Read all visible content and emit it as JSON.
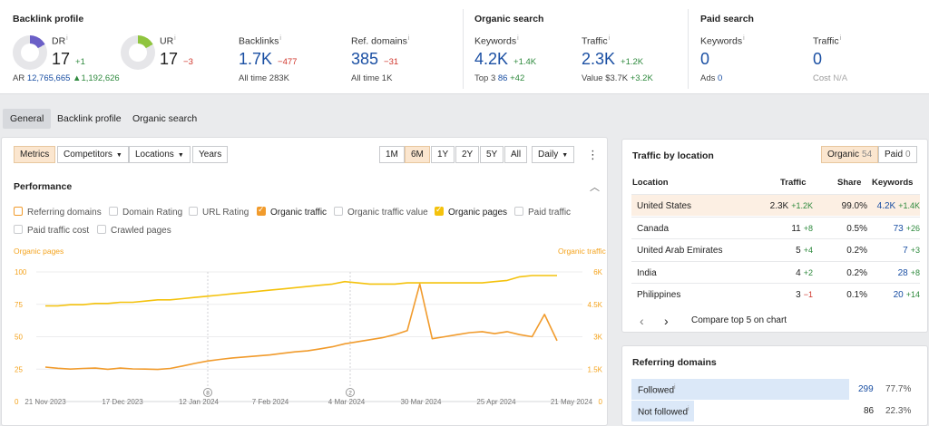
{
  "backlink_profile": {
    "title": "Backlink profile",
    "dr": {
      "label": "DR",
      "value": "17",
      "delta": "+1",
      "donut_fraction": 0.17
    },
    "ar": {
      "label": "AR",
      "value": "12,765,665",
      "delta": "1,192,626"
    },
    "ur": {
      "label": "UR",
      "value": "17",
      "delta": "−3",
      "donut_fraction": 0.17
    },
    "backlinks": {
      "label": "Backlinks",
      "value": "1.7K",
      "delta": "−477",
      "sub_label": "All time",
      "sub_value": "283K"
    },
    "ref_domains": {
      "label": "Ref. domains",
      "value": "385",
      "delta": "−31",
      "sub_label": "All time",
      "sub_value": "1K"
    }
  },
  "organic_search": {
    "title": "Organic search",
    "keywords": {
      "label": "Keywords",
      "value": "4.2K",
      "delta": "+1.4K",
      "sub_label": "Top 3",
      "sub_value": "86",
      "sub_delta": "+42"
    },
    "traffic": {
      "label": "Traffic",
      "value": "2.3K",
      "delta": "+1.2K",
      "sub_label": "Value",
      "sub_value": "$3.7K",
      "sub_delta": "+3.2K"
    }
  },
  "paid_search": {
    "title": "Paid search",
    "keywords": {
      "label": "Keywords",
      "value": "0",
      "sub_label": "Ads",
      "sub_value": "0"
    },
    "traffic": {
      "label": "Traffic",
      "value": "0",
      "sub_label": "Cost",
      "sub_value": "N/A"
    }
  },
  "tabs": [
    "General",
    "Backlink profile",
    "Organic search"
  ],
  "toolbar": {
    "metrics": "Metrics",
    "competitors": "Competitors",
    "locations": "Locations",
    "years": "Years",
    "ranges": [
      "1M",
      "6M",
      "1Y",
      "2Y",
      "5Y",
      "All"
    ],
    "interval": "Daily"
  },
  "performance": {
    "title": "Performance",
    "checkboxes": [
      "Referring domains",
      "Domain Rating",
      "URL Rating",
      "Organic traffic",
      "Organic traffic value",
      "Organic pages",
      "Paid traffic",
      "Paid traffic cost",
      "Crawled pages"
    ],
    "left_axis_title": "Organic pages",
    "right_axis_title": "Organic traffic"
  },
  "chart_data": {
    "type": "line",
    "x_labels": [
      "21 Nov 2023",
      "17 Dec 2023",
      "12 Jan 2024",
      "7 Feb 2024",
      "4 Mar 2024",
      "30 Mar 2024",
      "25 Apr 2024",
      "21 May 2024"
    ],
    "x_markers": [
      "8",
      "2"
    ],
    "left_axis": {
      "ticks": [
        "100",
        "75",
        "50",
        "25",
        "0"
      ],
      "ylim": [
        0,
        100
      ]
    },
    "right_axis": {
      "ticks": [
        "6K",
        "4.5K",
        "3K",
        "1.5K",
        "0"
      ],
      "ylim": [
        0,
        6000
      ]
    },
    "series": [
      {
        "name": "Organic pages",
        "color": "#f4c20d",
        "axis": "left",
        "values": [
          72,
          72,
          73,
          73,
          74,
          74,
          75,
          75,
          76,
          77,
          77,
          78,
          79,
          80,
          81,
          82,
          83,
          84,
          85,
          86,
          87,
          88,
          89,
          90,
          92,
          91,
          90,
          90,
          90,
          91,
          91,
          91,
          91,
          91,
          91,
          91,
          92,
          93,
          96,
          97,
          97,
          97
        ]
      },
      {
        "name": "Organic traffic",
        "color": "#f19b2c",
        "axis": "right",
        "values": [
          1300,
          1240,
          1200,
          1230,
          1250,
          1190,
          1250,
          1210,
          1200,
          1180,
          1230,
          1350,
          1480,
          1600,
          1680,
          1750,
          1800,
          1850,
          1900,
          1980,
          2050,
          2100,
          2200,
          2300,
          2450,
          2550,
          2650,
          2750,
          2900,
          3100,
          5400,
          2700,
          2800,
          2900,
          3000,
          3050,
          2950,
          3050,
          2900,
          2800,
          3900,
          2600
        ]
      }
    ]
  },
  "traffic_by_location": {
    "title": "Traffic by location",
    "organic_label": "Organic",
    "organic_count": "54",
    "paid_label": "Paid",
    "paid_count": "0",
    "columns": [
      "Location",
      "Traffic",
      "Share",
      "Keywords"
    ],
    "rows": [
      {
        "location": "United States",
        "traffic": "2.3K",
        "traffic_delta": "+1.2K",
        "share": "99.0%",
        "keywords": "4.2K",
        "keywords_delta": "+1.4K"
      },
      {
        "location": "Canada",
        "traffic": "11",
        "traffic_delta": "+8",
        "share": "0.5%",
        "keywords": "73",
        "keywords_delta": "+26"
      },
      {
        "location": "United Arab Emirates",
        "traffic": "5",
        "traffic_delta": "+4",
        "share": "0.2%",
        "keywords": "7",
        "keywords_delta": "+3"
      },
      {
        "location": "India",
        "traffic": "4",
        "traffic_delta": "+2",
        "share": "0.2%",
        "keywords": "28",
        "keywords_delta": "+8"
      },
      {
        "location": "Philippines",
        "traffic": "3",
        "traffic_delta": "−1",
        "share": "0.1%",
        "keywords": "20",
        "keywords_delta": "+14"
      }
    ],
    "compare": "Compare top 5 on chart"
  },
  "referring_domains": {
    "title": "Referring domains",
    "rows": [
      {
        "label": "Followed",
        "value": "299",
        "pct": "77.7%",
        "fraction": 0.777
      },
      {
        "label": "Not followed",
        "value": "86",
        "pct": "22.3%",
        "fraction": 0.223
      }
    ]
  }
}
